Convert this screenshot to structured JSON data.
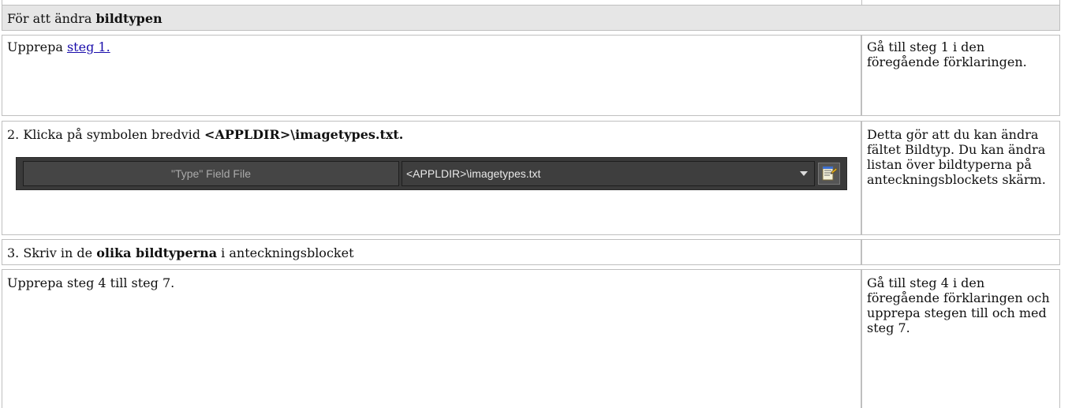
{
  "header": {
    "prefix": "För att ändra ",
    "bold": "bildtypen"
  },
  "rows": [
    {
      "left_prefix": "Upprepa ",
      "left_link": "steg 1.",
      "right": "Gå till steg 1 i den föregående förklaringen."
    },
    {
      "left_prefix": "2. Klicka på symbolen bredvid ",
      "left_bold": "<APPLDIR>\\imagetypes.txt.",
      "right": "Detta gör att du kan ändra fältet Bildtyp. Du kan ändra listan över bildtyperna på anteckningsblockets skärm."
    },
    {
      "left_prefix": "3. Skriv in de ",
      "left_bold": "olika bildtyperna",
      "left_suffix": " i anteckningsblocket",
      "right": ""
    },
    {
      "left": "Upprepa steg 4 till steg 7.",
      "right": "Gå till steg 4 i den föregående förklaringen och upprepa stegen till och med steg 7."
    }
  ],
  "widget": {
    "field_label": "\"Type\" Field File",
    "selected_value": "<APPLDIR>\\imagetypes.txt",
    "dropdown_icon": "chevron-down-icon",
    "edit_icon": "notepad-edit-icon"
  },
  "colors": {
    "header_bg": "#e6e6e6",
    "border": "#bfbfbf",
    "link": "#1a0dab",
    "widget_bg": "#3a3a3a"
  }
}
